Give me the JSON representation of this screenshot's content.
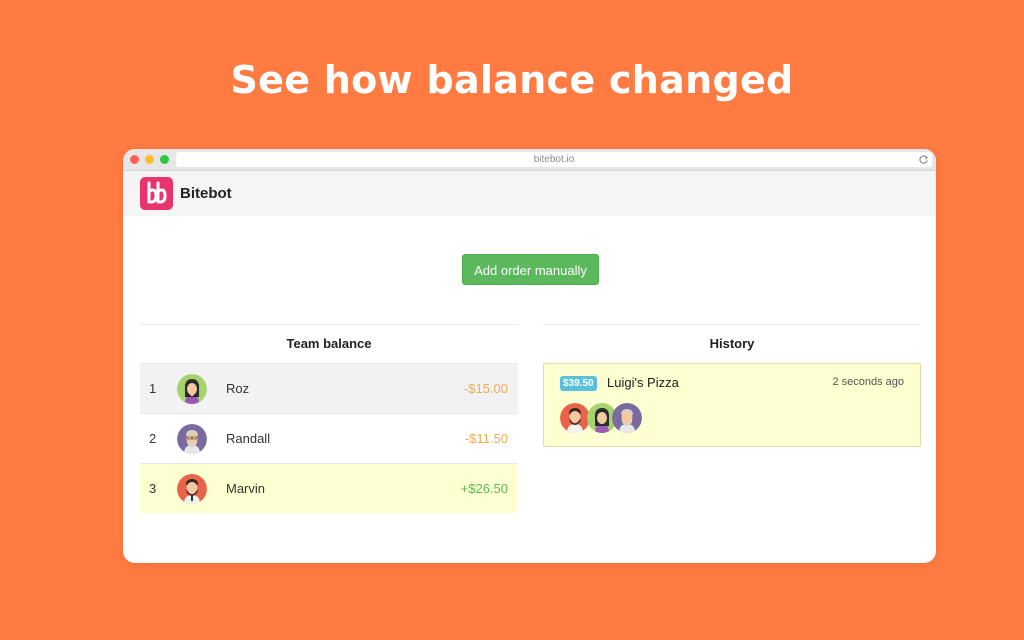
{
  "headline": "See how balance changed",
  "browser": {
    "url": "bitebot.io"
  },
  "app": {
    "name": "Bitebot",
    "brand_color": "#e8336d"
  },
  "actions": {
    "add_order_label": "Add order manually"
  },
  "team_balance": {
    "title": "Team balance",
    "rows": [
      {
        "rank": "1",
        "name": "Roz",
        "amount": "-$15.00",
        "avatar": "avatar-roz",
        "highlight": "#f2f2f2"
      },
      {
        "rank": "2",
        "name": "Randall",
        "amount": "-$11.50",
        "avatar": "avatar-randall",
        "highlight": "#ffffff"
      },
      {
        "rank": "3",
        "name": "Marvin",
        "amount": "+$26.50",
        "avatar": "avatar-marvin",
        "highlight": "#fdffd0"
      }
    ]
  },
  "history": {
    "title": "History",
    "entries": [
      {
        "price": "$39.50",
        "place": "Luigi's Pizza",
        "time": "2 seconds ago",
        "participants": [
          "avatar-marvin",
          "avatar-roz",
          "avatar-randall"
        ]
      }
    ]
  },
  "colors": {
    "background": "#ff7b42",
    "negative": "#f0ad4e",
    "positive": "#5cb85c",
    "badge": "#5bc0de",
    "button": "#5cb85c"
  }
}
